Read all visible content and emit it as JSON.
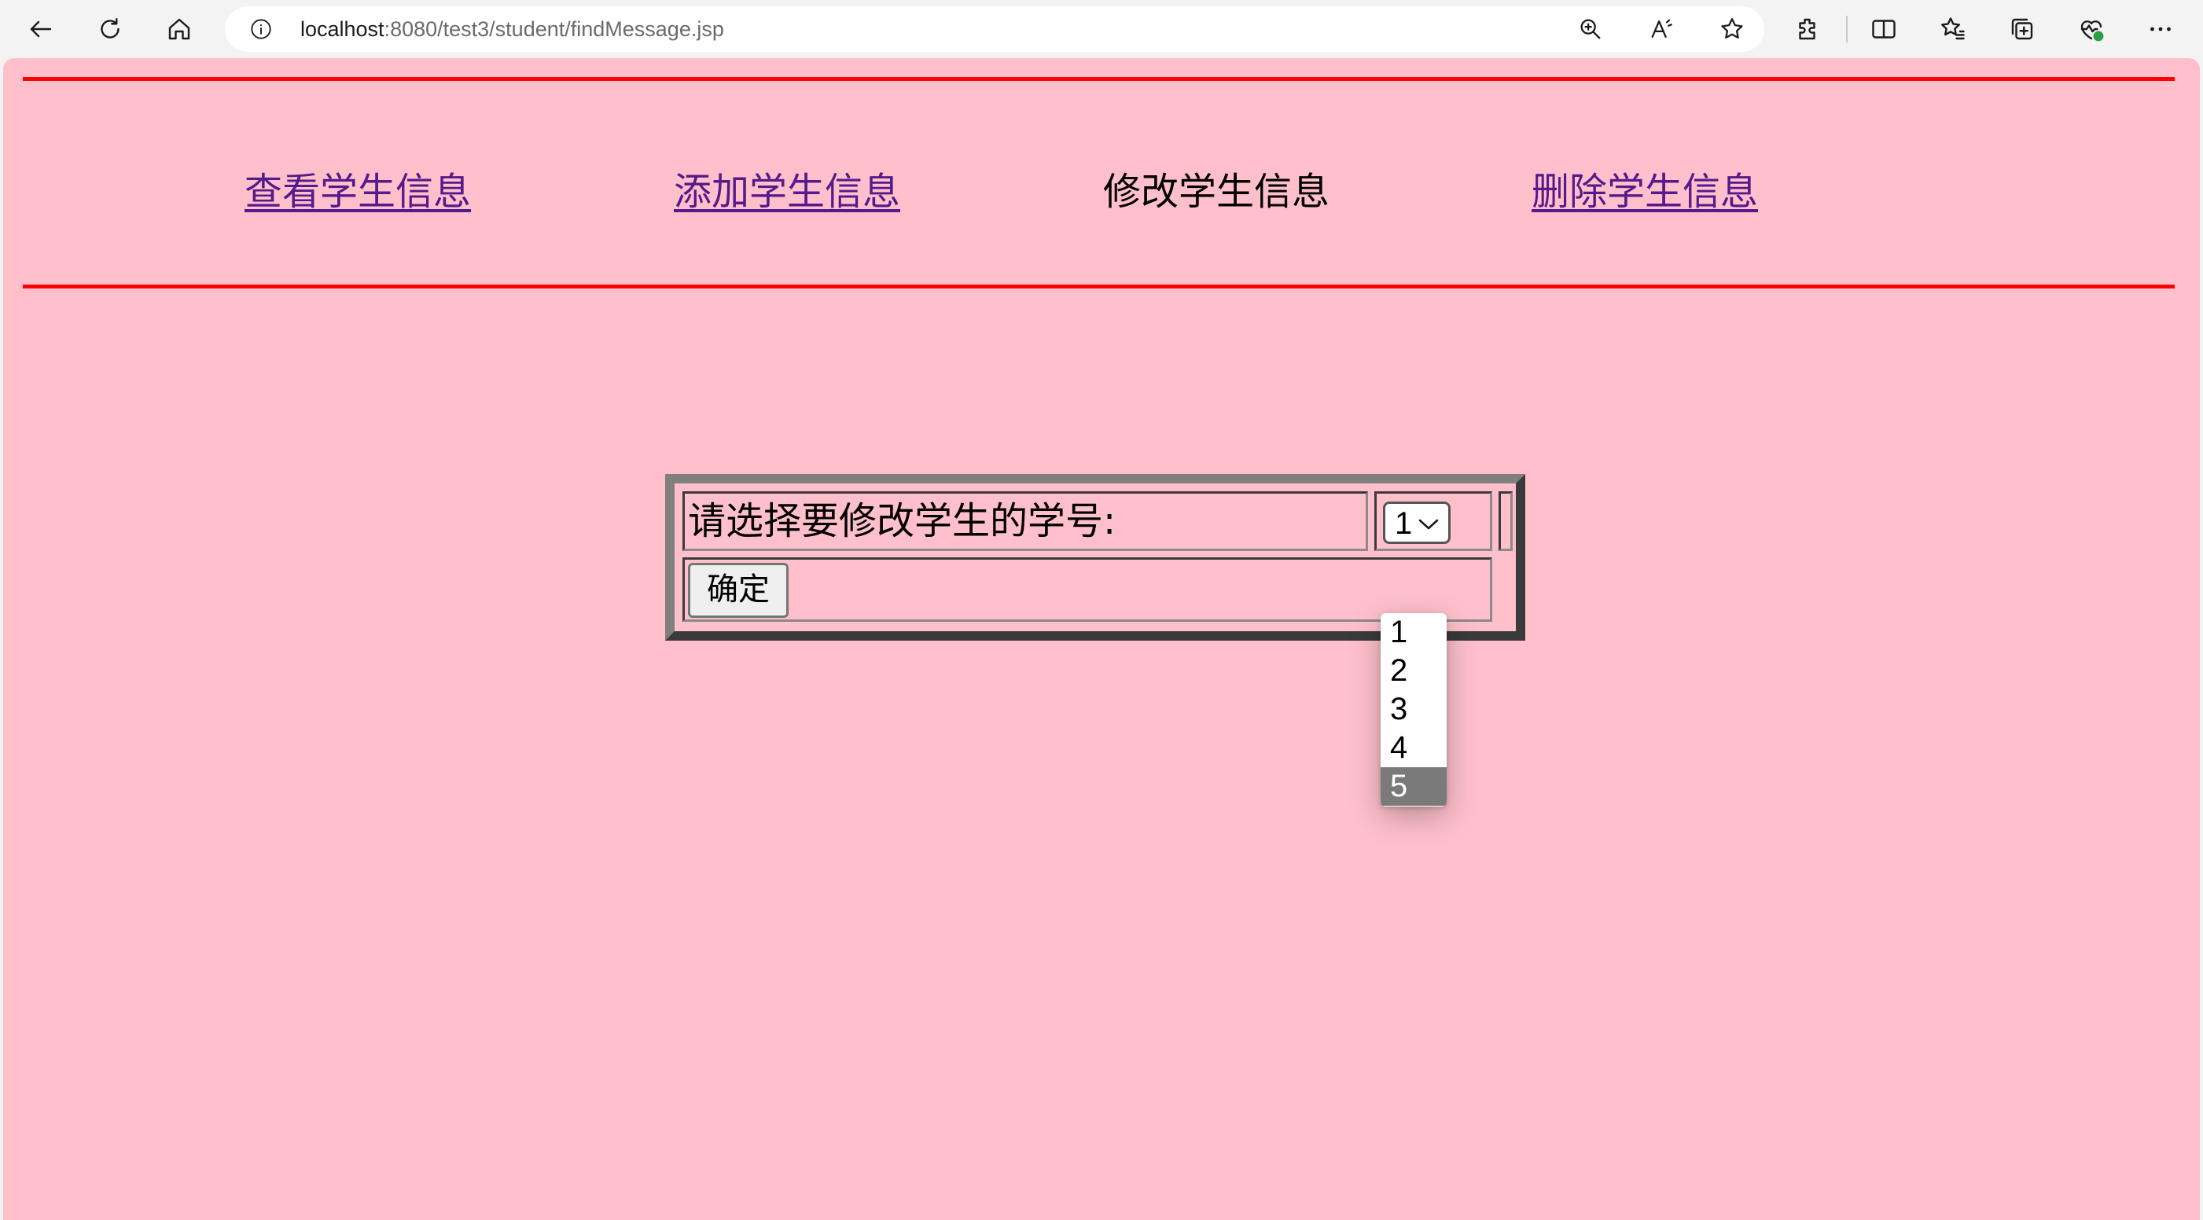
{
  "browser": {
    "url_host": "localhost",
    "url_rest": ":8080/test3/student/findMessage.jsp"
  },
  "nav": {
    "items": [
      {
        "label": "查看学生信息",
        "current": false
      },
      {
        "label": "添加学生信息",
        "current": false
      },
      {
        "label": "修改学生信息",
        "current": true
      },
      {
        "label": "删除学生信息",
        "current": false
      }
    ]
  },
  "form": {
    "title": "修改学生信息",
    "prompt_label": "请选择要修改学生的学号:",
    "select_value": "1",
    "options": [
      "1",
      "2",
      "3",
      "4",
      "5"
    ],
    "highlighted_option": "5",
    "submit_label": "确定"
  },
  "colors": {
    "page_background": "#ffc0cb",
    "rule": "#ff0000",
    "link": "#551a8b"
  }
}
